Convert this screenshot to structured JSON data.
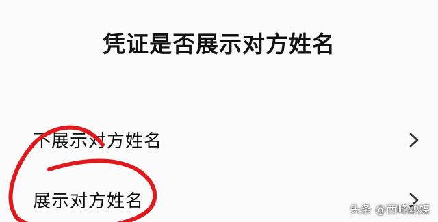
{
  "title": "凭证是否展示对方姓名",
  "options": [
    {
      "label": "不展示对方姓名",
      "icon": "chevron-right-icon"
    },
    {
      "label": "展示对方姓名",
      "icon": "chevron-right-icon"
    }
  ],
  "annotation": {
    "color": "#e0191c",
    "shape": "circle-around-option-2"
  },
  "watermark": "头条 @西峰融媒"
}
